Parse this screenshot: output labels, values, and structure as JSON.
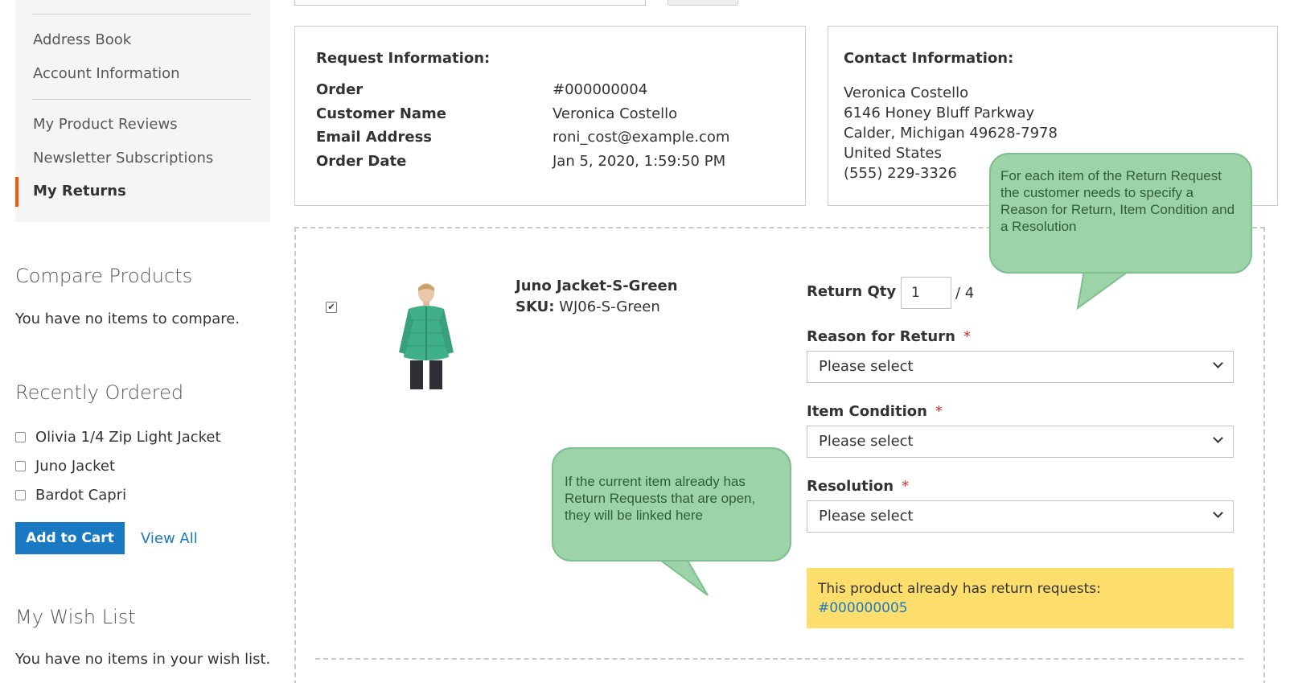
{
  "sidebar": {
    "nav": [
      {
        "label": "Address Book"
      },
      {
        "label": "Account Information"
      },
      {
        "label": "My Product Reviews"
      },
      {
        "label": "Newsletter Subscriptions"
      },
      {
        "label": "My Returns"
      }
    ],
    "compare": {
      "title": "Compare Products",
      "empty_text": "You have no items to compare."
    },
    "recently_ordered": {
      "title": "Recently Ordered",
      "items": [
        "Olivia 1/4 Zip Light Jacket",
        "Juno Jacket",
        "Bardot Capri"
      ],
      "add_to_cart_label": "Add to Cart",
      "view_all_label": "View All"
    },
    "wishlist": {
      "title": "My Wish List",
      "empty_text": "You have no items in your wish list."
    }
  },
  "request_info": {
    "title": "Request Information:",
    "rows": [
      {
        "label": "Order",
        "value": "#000000004"
      },
      {
        "label": "Customer Name",
        "value": "Veronica Costello"
      },
      {
        "label": "Email Address",
        "value": "roni_cost@example.com"
      },
      {
        "label": "Order Date",
        "value": "Jan 5, 2020, 1:59:50 PM"
      }
    ]
  },
  "contact_info": {
    "title": "Contact Information:",
    "lines": [
      "Veronica Costello",
      "6146 Honey Bluff Parkway",
      "Calder, Michigan 49628-7978",
      "United States",
      "(555) 229-3326"
    ]
  },
  "item": {
    "checked": true,
    "name": "Juno Jacket-S-Green",
    "sku_label": "SKU:",
    "sku": "WJ06-S-Green",
    "return_qty_label": "Return Qty",
    "return_qty_value": "1",
    "return_qty_max": "/ 4",
    "reason_label": "Reason for Return",
    "condition_label": "Item Condition",
    "resolution_label": "Resolution",
    "required_mark": "*",
    "select_placeholder": "Please select",
    "notice_text": "This product already has return requests:",
    "notice_link": "#000000005"
  },
  "callouts": {
    "top": "For each item of the Return Request the customer needs to specify a Reason for Return, Item Condition and a Resolution",
    "bottom": "If the current item already has Return Requests that are open, they will be linked here"
  },
  "colors": {
    "link": "#1979c3",
    "primary_button": "#1979c3",
    "nav_active_bar": "#ff5501",
    "notice_bg": "#fdde6c",
    "callout_bg": "#9dd3a8",
    "required": "#e02b27"
  }
}
